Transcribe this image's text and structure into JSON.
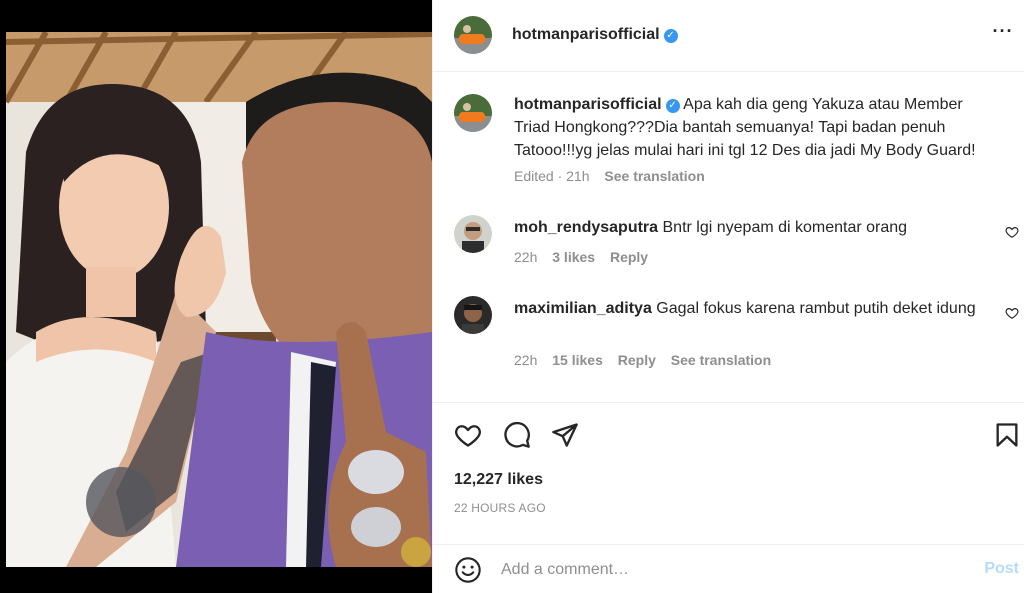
{
  "post": {
    "author": "hotmanparisofficial",
    "more_icon": "more-horizontal-icon",
    "verified_icon": "verified-badge-icon"
  },
  "caption": {
    "username": "hotmanparisofficial",
    "text": "Apa kah dia geng Yakuza atau Member Triad Hongkong???Dia bantah semuanya! Tapi badan penuh Tatooo!!!yg jelas mulai hari ini tgl 12 Des dia jadi My Body Guard!",
    "edited": "Edited · 21h",
    "see_translation": "See translation"
  },
  "comments": [
    {
      "username": "moh_rendysaputra",
      "text": "Bntr lgi nyepam di komentar orang",
      "time": "22h",
      "likes": "3 likes",
      "reply": "Reply"
    },
    {
      "username": "maximilian_aditya",
      "text": "Gagal fokus karena rambut putih deket idung",
      "time": "22h",
      "likes": "15 likes",
      "reply": "Reply",
      "see_translation": "See translation"
    }
  ],
  "actions": {
    "icons": [
      "heart-icon",
      "comment-icon",
      "share-icon",
      "bookmark-icon"
    ],
    "likes": "12,227 likes",
    "timestamp": "22 HOURS AGO"
  },
  "composer": {
    "placeholder": "Add a comment…",
    "post_label": "Post",
    "emoji_icon": "emoji-icon"
  },
  "colors": {
    "verified": "#3897f0",
    "post_button_disabled": "#b3dbff",
    "secondary_text": "#8e8e8e",
    "border": "#efefef"
  }
}
